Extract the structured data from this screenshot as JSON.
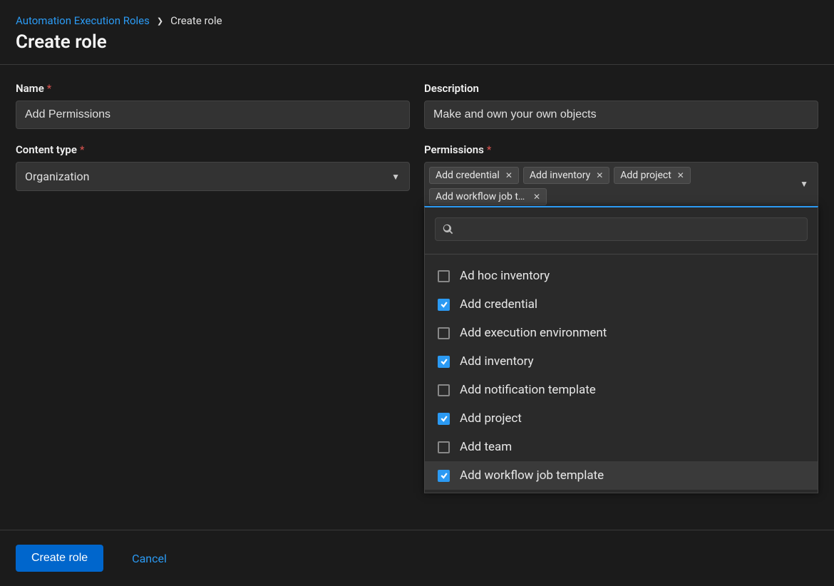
{
  "breadcrumb": {
    "parent": "Automation Execution Roles",
    "current": "Create role"
  },
  "page_title": "Create role",
  "fields": {
    "name": {
      "label": "Name",
      "value": "Add Permissions"
    },
    "description": {
      "label": "Description",
      "value": "Make and own your own objects"
    },
    "content_type": {
      "label": "Content type",
      "value": "Organization"
    },
    "permissions": {
      "label": "Permissions",
      "selected_chips": [
        {
          "label": "Add credential"
        },
        {
          "label": "Add inventory"
        },
        {
          "label": "Add project"
        },
        {
          "label": "Add workflow job tem..."
        }
      ],
      "search_placeholder": "",
      "options": [
        {
          "label": "Ad hoc inventory",
          "checked": false,
          "highlight": false
        },
        {
          "label": "Add credential",
          "checked": true,
          "highlight": false
        },
        {
          "label": "Add execution environment",
          "checked": false,
          "highlight": false
        },
        {
          "label": "Add inventory",
          "checked": true,
          "highlight": false
        },
        {
          "label": "Add notification template",
          "checked": false,
          "highlight": false
        },
        {
          "label": "Add project",
          "checked": true,
          "highlight": false
        },
        {
          "label": "Add team",
          "checked": false,
          "highlight": false
        },
        {
          "label": "Add workflow job template",
          "checked": true,
          "highlight": true
        }
      ]
    }
  },
  "footer": {
    "primary": "Create role",
    "cancel": "Cancel"
  }
}
